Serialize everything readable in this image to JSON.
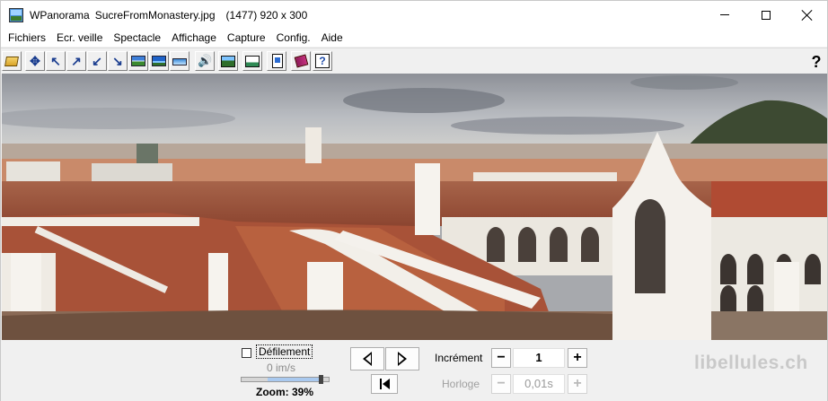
{
  "window": {
    "app_name": "WPanorama",
    "file_name": "SucreFromMonastery.jpg",
    "dimensions_text": "(1477) 920 x 300"
  },
  "menu": [
    "Fichiers",
    "Ecr. veille",
    "Spectacle",
    "Affichage",
    "Capture",
    "Config.",
    "Aide"
  ],
  "toolbar": {
    "buttons": [
      {
        "icon": "open-folder-icon"
      },
      {
        "icon": "move-all-icon"
      },
      {
        "icon": "arrow-up-left-icon"
      },
      {
        "icon": "arrow-up-right-icon"
      },
      {
        "icon": "arrow-down-left-icon"
      },
      {
        "icon": "arrow-down-right-icon"
      },
      {
        "icon": "panorama-view-icon"
      },
      {
        "icon": "panorama-sky-icon"
      },
      {
        "icon": "panorama-strip-icon"
      },
      {
        "icon": "sound-icon"
      },
      {
        "icon": "landscape-icon"
      },
      {
        "icon": "tools-icon"
      },
      {
        "icon": "document-icon"
      },
      {
        "icon": "book-icon"
      },
      {
        "icon": "help-context-icon"
      }
    ],
    "help_label": "?"
  },
  "panorama": {
    "alt": "Panorama of Sucre seen from the monastery"
  },
  "controls": {
    "scroll_label": "Défilement",
    "scroll_checked": false,
    "speed_text": "0 im/s",
    "zoom_text": "Zoom: 39%",
    "zoom_level": 0.39,
    "increment_label": "Incrément",
    "increment_value": "1",
    "minus_label": "−",
    "plus_label": "+",
    "clock_label": "Horloge",
    "clock_value": "0,01s",
    "watermark": "libellules.ch"
  }
}
